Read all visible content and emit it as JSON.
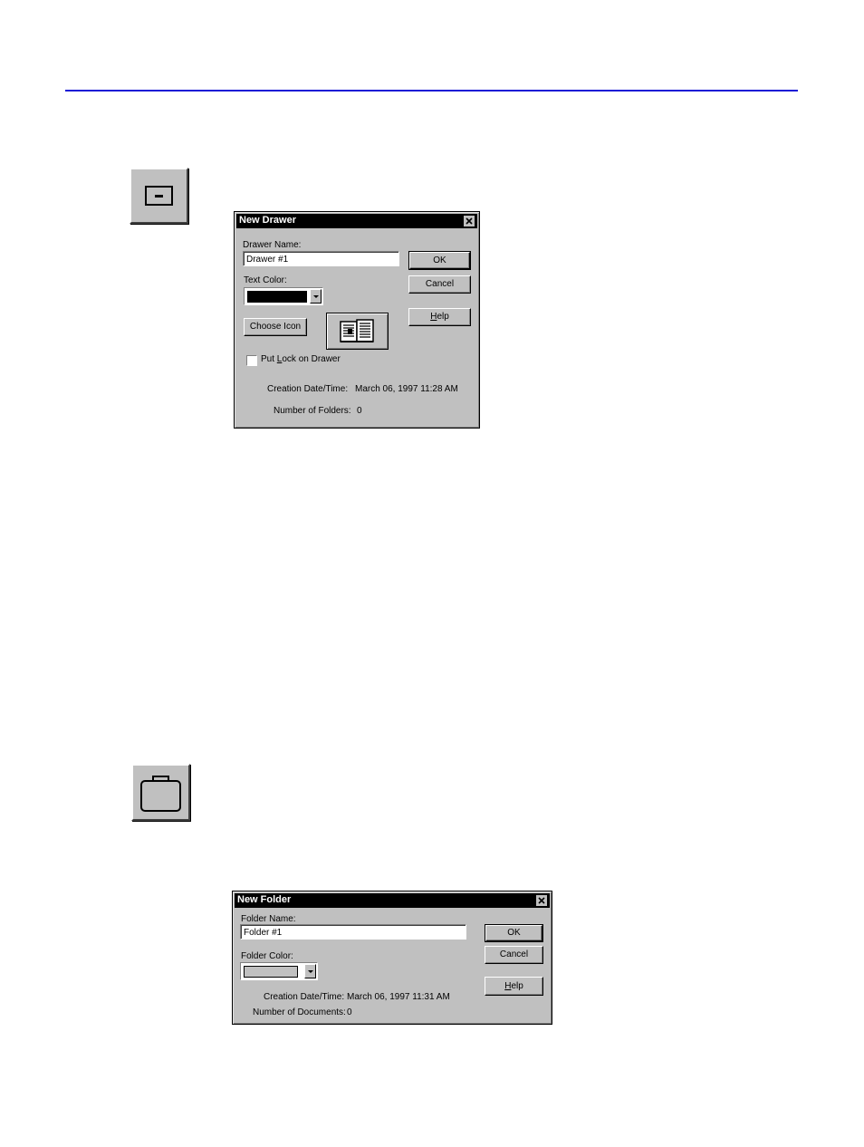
{
  "toolbar_icons": {
    "drawer_icon": "drawer-icon",
    "folder_icon": "folder-icon"
  },
  "drawer_dialog": {
    "title": "New Drawer",
    "name_label": "Drawer Name:",
    "name_value": "Drawer #1",
    "text_color_label": "Text Color:",
    "text_color_value": "#000000",
    "choose_icon_label": "Choose Icon",
    "preview_icon": "documents-icon",
    "lock_label_pre": "Put ",
    "lock_label_key": "L",
    "lock_label_post": "ock on Drawer",
    "lock_checked": false,
    "created_label": "Creation Date/Time:",
    "created_value": "March 06, 1997 11:28 AM",
    "folders_label": "Number of Folders:",
    "folders_value": "0",
    "ok_label": "OK",
    "cancel_label": "Cancel",
    "help_key": "H",
    "help_rest": "elp"
  },
  "folder_dialog": {
    "title": "New Folder",
    "name_label": "Folder Name:",
    "name_value": "Folder #1",
    "color_label": "Folder Color:",
    "color_value": "#c0c0c0",
    "created_label": "Creation Date/Time:",
    "created_value": "March 06, 1997 11:31 AM",
    "docs_label": "Number of Documents:",
    "docs_value": "0",
    "ok_label": "OK",
    "cancel_label": "Cancel",
    "help_key": "H",
    "help_rest": "elp"
  },
  "colors": {
    "rule": "#1a1ad6",
    "dialog_bg": "#c0c0c0"
  }
}
